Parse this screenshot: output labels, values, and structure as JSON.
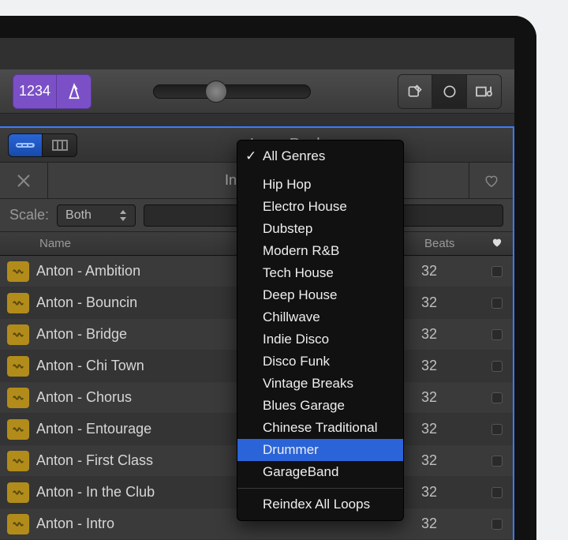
{
  "toolbar": {
    "count_label": "1234"
  },
  "browser": {
    "title": "Loop Packs",
    "filter_label": "Instrument",
    "scale_label": "Scale:",
    "scale_value": "Both",
    "cols": {
      "name": "Name",
      "beats": "Beats"
    },
    "loops": [
      {
        "name": "Anton - Ambition",
        "beats": "32"
      },
      {
        "name": "Anton - Bouncin",
        "beats": "32"
      },
      {
        "name": "Anton - Bridge",
        "beats": "32"
      },
      {
        "name": "Anton - Chi Town",
        "beats": "32"
      },
      {
        "name": "Anton - Chorus",
        "beats": "32"
      },
      {
        "name": "Anton - Entourage",
        "beats": "32"
      },
      {
        "name": "Anton - First Class",
        "beats": "32"
      },
      {
        "name": "Anton - In the Club",
        "beats": "32"
      },
      {
        "name": "Anton - Intro",
        "beats": "32"
      }
    ]
  },
  "dropdown": {
    "items": [
      {
        "label": "All Genres",
        "checked": true,
        "selected": false
      },
      {
        "label": "Hip Hop"
      },
      {
        "label": "Electro House"
      },
      {
        "label": "Dubstep"
      },
      {
        "label": "Modern R&B"
      },
      {
        "label": "Tech House"
      },
      {
        "label": "Deep House"
      },
      {
        "label": "Chillwave"
      },
      {
        "label": "Indie Disco"
      },
      {
        "label": "Disco Funk"
      },
      {
        "label": "Vintage Breaks"
      },
      {
        "label": "Blues Garage"
      },
      {
        "label": "Chinese Traditional"
      },
      {
        "label": "Drummer",
        "selected": true
      },
      {
        "label": "GarageBand"
      }
    ],
    "footer": "Reindex All Loops"
  }
}
